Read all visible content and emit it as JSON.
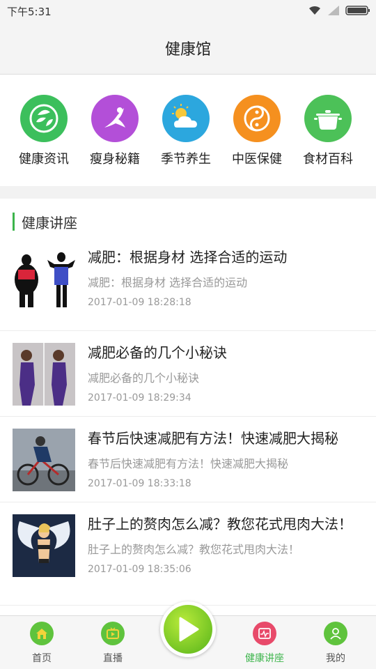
{
  "status": {
    "time": "下午5:31"
  },
  "header": {
    "title": "健康馆"
  },
  "categories": [
    {
      "label": "健康资讯",
      "icon": "leaf-icon",
      "color": "#3cbf5c"
    },
    {
      "label": "瘦身秘籍",
      "icon": "yoga-icon",
      "color": "#b34fd8"
    },
    {
      "label": "季节养生",
      "icon": "weather-icon",
      "color": "#2ca7de"
    },
    {
      "label": "中医保健",
      "icon": "taiji-icon",
      "color": "#f5901f"
    },
    {
      "label": "食材百科",
      "icon": "pot-icon",
      "color": "#4cc158"
    }
  ],
  "section": {
    "title": "健康讲座"
  },
  "articles": [
    {
      "title": "减肥：根据身材 选择合适的运动",
      "subtitle": "减肥：根据身材 选择合适的运动",
      "time": "2017-01-09 18:28:18"
    },
    {
      "title": "减肥必备的几个小秘诀",
      "subtitle": "减肥必备的几个小秘诀",
      "time": "2017-01-09 18:29:34"
    },
    {
      "title": "春节后快速减肥有方法！快速减肥大揭秘",
      "subtitle": "春节后快速减肥有方法！快速减肥大揭秘",
      "time": "2017-01-09 18:33:18"
    },
    {
      "title": "肚子上的赘肉怎么减？教您花式甩肉大法！",
      "subtitle": "肚子上的赘肉怎么减？教您花式甩肉大法！",
      "time": "2017-01-09 18:35:06"
    }
  ],
  "tabs": [
    {
      "label": "首页",
      "icon": "home-icon"
    },
    {
      "label": "直播",
      "icon": "tv-icon"
    },
    {
      "label": "健康讲座",
      "icon": "heart-monitor-icon",
      "active": true
    },
    {
      "label": "我的",
      "icon": "person-icon"
    }
  ],
  "colors": {
    "accent": "#3cb44b",
    "tab_green": "#5fc33d",
    "tab_active": "#e84a6a"
  }
}
